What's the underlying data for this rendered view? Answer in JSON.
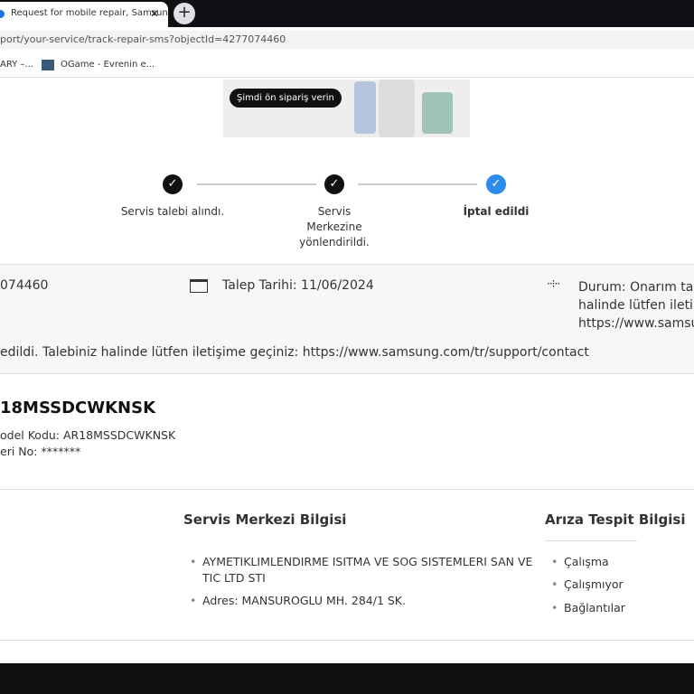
{
  "browser": {
    "tab_title": "Request for mobile repair, Samsung",
    "url": "port/your-service/track-repair-sms?objectId=4277074460",
    "bookmarks": [
      "ARY –...",
      "OGame - Evrenin e..."
    ]
  },
  "banner": {
    "cta": "Şimdi ön sipariş verin"
  },
  "progress": {
    "steps": [
      {
        "label": "Servis talebi alındı.",
        "state": "done"
      },
      {
        "label": "Servis Merkezine yönlendirildi.",
        "state": "done"
      },
      {
        "label": "İptal edildi",
        "state": "current"
      }
    ],
    "accent": "#2d8ceb"
  },
  "request": {
    "id": "074460",
    "date": "Talep Tarihi: 11/06/2024",
    "status_lines": [
      "Durum: Onarım tal",
      "halinde lütfen ileti",
      "https://www.samsu"
    ],
    "message": "edildi. Talebiniz halinde lütfen iletişime geçiniz: https://www.samsung.com/tr/support/contact"
  },
  "product": {
    "title": "18MSSDCWKNSK",
    "model": "odel Kodu: AR18MSSDCWKNSK",
    "serial": "eri No: *******"
  },
  "service_center": {
    "heading": "Servis Merkezi Bilgisi",
    "items": [
      "AYMETIKLIMLENDIRME ISITMA VE SOG SISTEMLERI SAN VE TIC LTD STI",
      "Adres: MANSUROGLU MH. 284/1 SK."
    ]
  },
  "fault": {
    "heading": "Arıza Tespit Bilgisi",
    "items": [
      "Çalışma",
      "Çalışmıyor",
      "Bağlantılar"
    ]
  }
}
